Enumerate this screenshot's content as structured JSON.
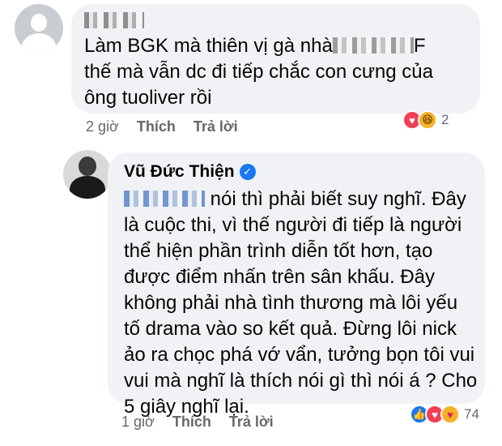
{
  "comment_1": {
    "author_visible": "",
    "text_line_1": "Làm BGK mà thiên vị gà nhà",
    "text_line_1_tail": "F",
    "text_rest": "thế mà vẫn dc đi tiếp chắc con cưng của\nông tuoliver rồi",
    "time": "2 giờ",
    "like_label": "Thích",
    "reply_label": "Trả lời",
    "reaction_count": "2",
    "reactions": [
      "love",
      "haha"
    ]
  },
  "comment_2": {
    "author": "Vũ Đức Thiện",
    "text_lead": " nói thì phải biết suy nghĩ. Đây",
    "text_rest": "là cuộc thi, vì thế người đi tiếp là người\nthể hiện phần trình diễn tốt hơn, tạo\nđược điểm nhấn trên sân khấu. Đây\nkhông phải nhà tình thương mà lôi yếu\ntố drama vào so kết quả. Đừng lôi nick\nảo ra chọc phá vớ vẩn, tưởng bọn tôi vui\nvui mà nghĩ là thích nói gì thì nói á ? Cho\n5 giây nghĩ lại.",
    "time": "1 giờ",
    "like_label": "Thích",
    "reply_label": "Trả lời",
    "reaction_count": "74",
    "reactions": [
      "like",
      "love",
      "care"
    ]
  },
  "icons": {
    "verified": "✓",
    "like": "👍",
    "love": "♥",
    "haha": "😆",
    "care": "♥"
  },
  "colors": {
    "bubble": "#f0f2f5",
    "meta_text": "#65676b",
    "like_blue": "#1877f2",
    "love_red": "#f33e58",
    "haha_yellow": "#f7b125"
  }
}
